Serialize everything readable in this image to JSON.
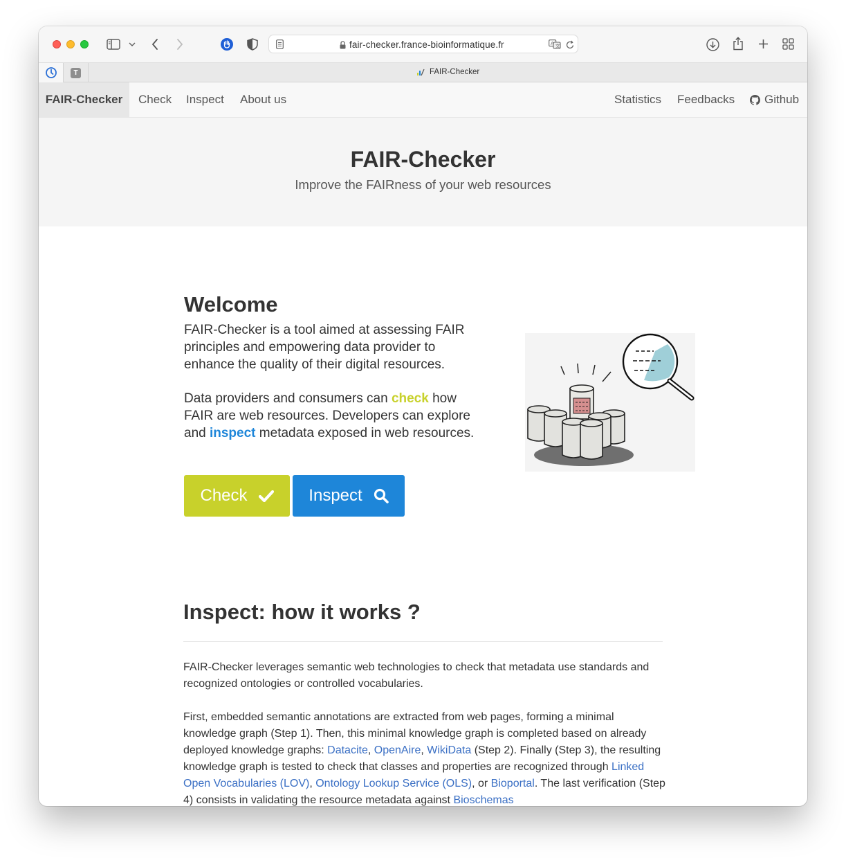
{
  "browser": {
    "url": "fair-checker.france-bioinformatique.fr",
    "pinned_tab_letter": "T",
    "tab_title": "FAIR-Checker"
  },
  "nav": {
    "brand": "FAIR-Checker",
    "left_items": [
      "Check",
      "Inspect",
      "About us"
    ],
    "right_items": [
      "Statistics",
      "Feedbacks",
      "Github"
    ]
  },
  "hero": {
    "title": "FAIR-Checker",
    "subtitle": "Improve the FAIRness of your web resources"
  },
  "welcome": {
    "title": "Welcome",
    "para1": "FAIR-Checker is a tool aimed at assessing FAIR principles and empowering data provider to enhance the quality of their digital resources.",
    "para2_a": "Data providers and consumers can ",
    "para2_check": "check",
    "para2_b": " how FAIR are web resources. Developers can explore and ",
    "para2_inspect": "inspect",
    "para2_c": " metadata exposed in web resources.",
    "check_button": "Check",
    "inspect_button": "Inspect"
  },
  "how": {
    "title": "Inspect: how it works ?",
    "p1": "FAIR-Checker leverages semantic web technologies to check that metadata use standards and recognized ontologies or controlled vocabularies.",
    "p2_a": "First, embedded semantic annotations are extracted from web pages, forming a minimal knowledge graph (Step 1). Then, this minimal knowledge graph is completed based on already deployed knowledge graphs: ",
    "link_datacite": "Datacite",
    "sep1": ", ",
    "link_openaire": "OpenAire",
    "sep2": ", ",
    "link_wikidata": "WikiData",
    "p2_b": " (Step 2). Finally (Step 3), the resulting knowledge graph is tested to check that classes and properties are recognized through ",
    "link_lov": "Linked Open Vocabularies (LOV)",
    "sep3": ", ",
    "link_ols": "Ontology Lookup Service (OLS)",
    "sep4": ", or ",
    "link_bioportal": "Bioportal",
    "p2_c": ". The last verification (Step 4) consists in validating the resource metadata against ",
    "link_bioschemas": "Bioschemas"
  },
  "colors": {
    "check": "#c8d12b",
    "inspect": "#1e86d9",
    "link": "#3a6fc4"
  }
}
